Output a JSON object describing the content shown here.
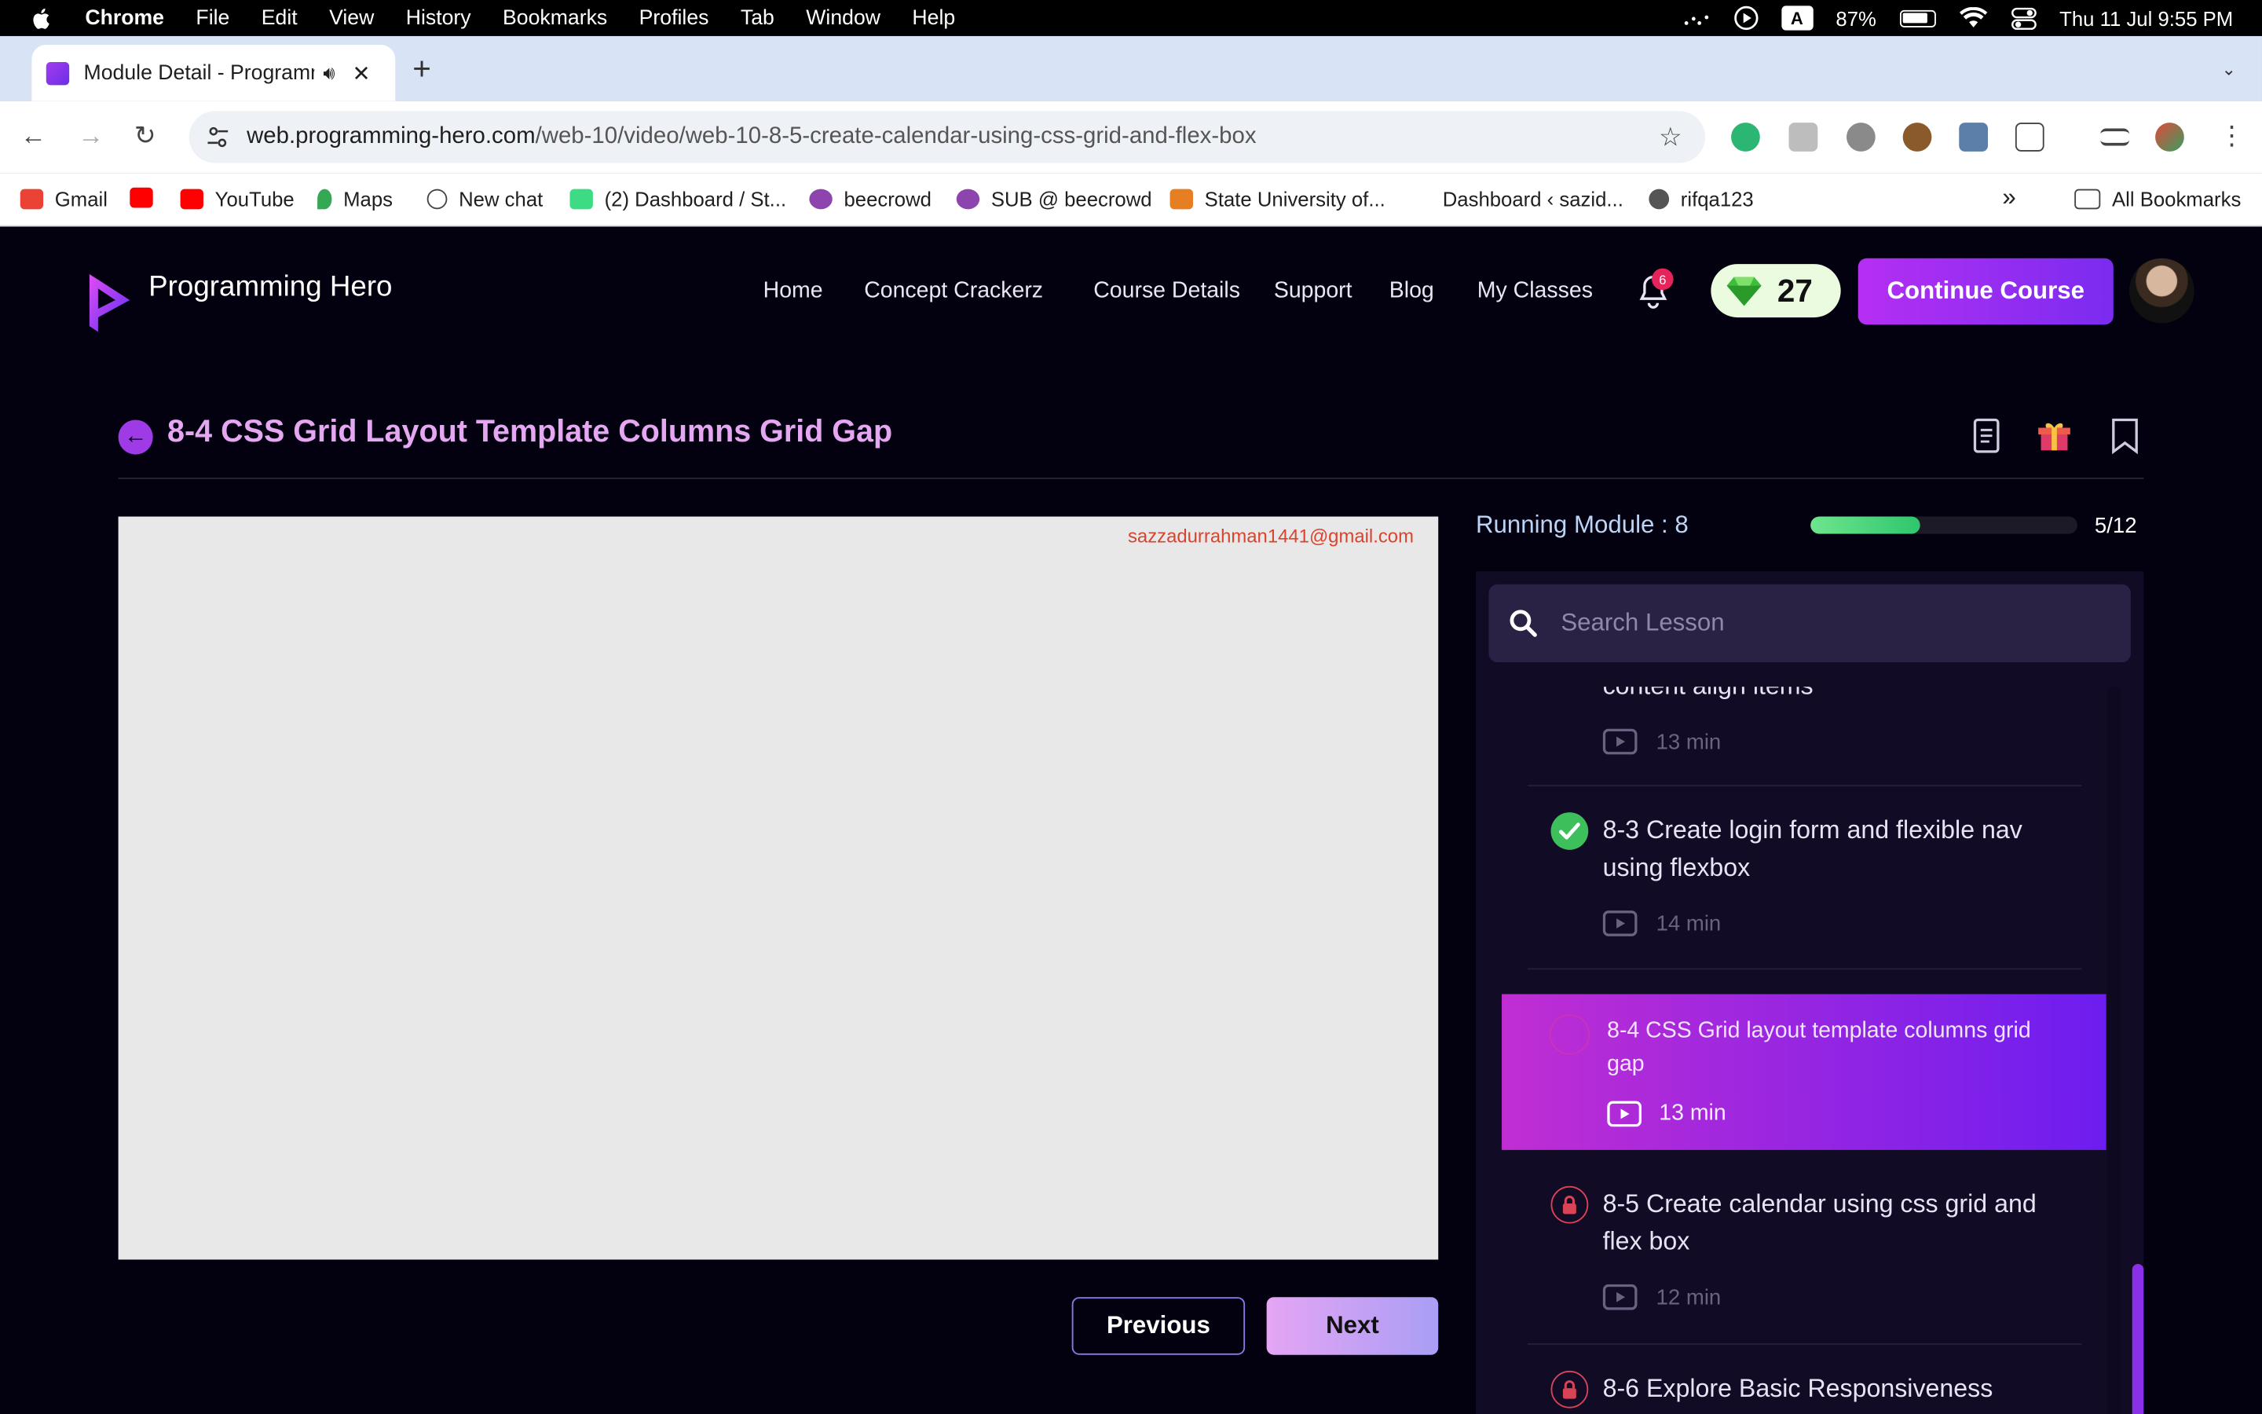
{
  "menubar": {
    "app": "Chrome",
    "items": [
      "File",
      "Edit",
      "View",
      "History",
      "Bookmarks",
      "Profiles",
      "Tab",
      "Window",
      "Help"
    ],
    "input_source": "A",
    "battery": "87%",
    "datetime": "Thu 11 Jul  9:55 PM"
  },
  "browser": {
    "tab_title": "Module Detail - Programming Hero",
    "url_host": "web.programming-hero.com",
    "url_path": "/web-10/video/web-10-8-5-create-calendar-using-css-grid-and-flex-box",
    "bookmarks": [
      {
        "label": "Gmail",
        "color": "#ea4335"
      },
      {
        "label": "",
        "color": "#ff0000"
      },
      {
        "label": "YouTube",
        "color": "#ff0000"
      },
      {
        "label": "Maps",
        "color": "#34a853"
      },
      {
        "label": "New chat",
        "color": "#444444"
      },
      {
        "label": "(2) Dashboard / St...",
        "color": "#3ddc84"
      },
      {
        "label": "beecrowd",
        "color": "#8e44ad"
      },
      {
        "label": "SUB @ beecrowd",
        "color": "#8e44ad"
      },
      {
        "label": "State University of...",
        "color": "#e67e22"
      },
      {
        "label": "Dashboard ‹ sazid...",
        "color": "#ffffff"
      },
      {
        "label": "rifqa123",
        "color": "#555555"
      }
    ],
    "more_bookmarks": "»",
    "all_bookmarks": "All Bookmarks"
  },
  "site": {
    "brand": "Programming Hero",
    "nav": [
      "Home",
      "Concept Crackerz",
      "Course Details",
      "Support",
      "Blog",
      "My Classes"
    ],
    "notification_count": "6",
    "gems": "27",
    "continue_label": "Continue Course",
    "page_title": "8-4 CSS Grid Layout Template Columns Grid Gap",
    "watermark": "sazzadurrahman1441@gmail.com",
    "previous_label": "Previous",
    "next_label": "Next",
    "running_module": "Running Module : 8",
    "progress_fraction": 0.41,
    "progress_count": "5/12",
    "search_placeholder": "Search Lesson",
    "lessons": [
      {
        "title": "content align items",
        "duration": "13 min",
        "status": "done"
      },
      {
        "title": "8-3 Create login form and flexible nav using flexbox",
        "duration": "14 min",
        "status": "done"
      },
      {
        "title": "8-4 CSS Grid layout template columns grid gap",
        "duration": "13 min",
        "status": "active"
      },
      {
        "title": "8-5 Create calendar using css grid and flex box",
        "duration": "12 min",
        "status": "locked"
      },
      {
        "title": "8-6 Explore Basic Responsiveness",
        "duration": "",
        "status": "locked"
      }
    ]
  }
}
